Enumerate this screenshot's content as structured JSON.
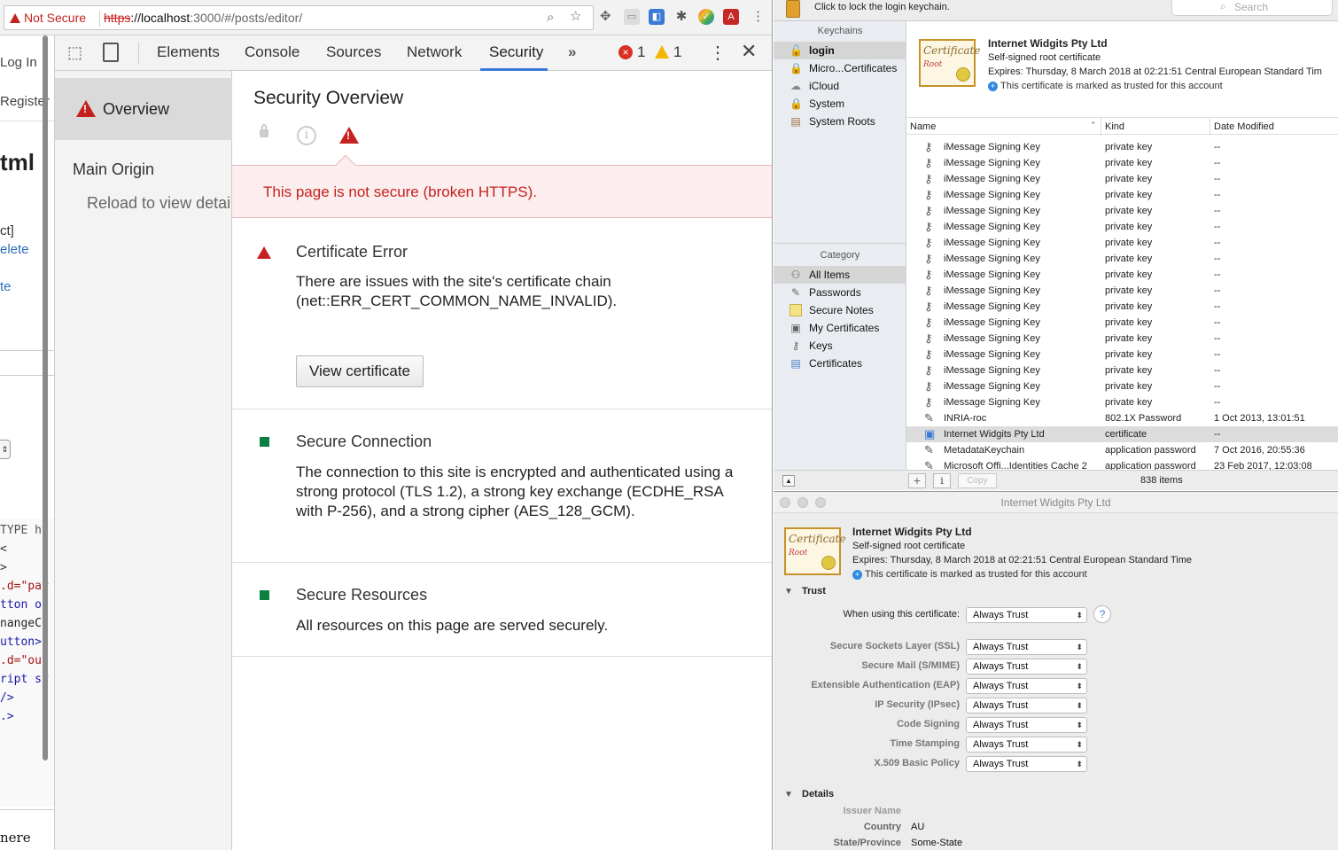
{
  "browser": {
    "not_secure_label": "Not Secure",
    "url_scheme": "https",
    "url_host": "://localhost",
    "url_rest": ":3000/#/posts/editor/"
  },
  "page": {
    "login_link": "Log In",
    "register_link": "Register",
    "heading_fragment": "tml",
    "bracket_fragment": "ct]",
    "delete_fragment": "elete",
    "te_fragment": "te",
    "code_lines": [
      "TYPE ht",
      "<",
      ">",
      ".d=\"par",
      "tton on",
      "nangeCo",
      "utton>",
      ".d=\"out",
      "ript sr",
      "/>",
      ".>"
    ],
    "bottom_fragment": "nere"
  },
  "devtools": {
    "tabs": [
      "Elements",
      "Console",
      "Sources",
      "Network",
      "Security"
    ],
    "more_tabs": "»",
    "error_count": "1",
    "warning_count": "1",
    "sidebar": {
      "overview": "Overview",
      "main_origin": "Main Origin",
      "reload_hint": "Reload to view detai"
    },
    "title": "Security Overview",
    "banner": "This page is not secure (broken HTTPS).",
    "sections": [
      {
        "title": "Certificate Error",
        "body": "There are issues with the site's certificate chain (net::ERR_CERT_COMMON_NAME_INVALID).",
        "button": "View certificate"
      },
      {
        "title": "Secure Connection",
        "body": "The connection to this site is encrypted and authenticated using a strong protocol (TLS 1.2), a strong key exchange (ECDHE_RSA with P-256), and a strong cipher (AES_128_GCM)."
      },
      {
        "title": "Secure Resources",
        "body": "All resources on this page are served securely."
      }
    ]
  },
  "keychain": {
    "lock_hint": "Click to lock the login keychain.",
    "search_placeholder": "Search",
    "keychains_header": "Keychains",
    "keychains": [
      "login",
      "Micro...Certificates",
      "iCloud",
      "System",
      "System Roots"
    ],
    "category_header": "Category",
    "categories": [
      "All Items",
      "Passwords",
      "Secure Notes",
      "My Certificates",
      "Keys",
      "Certificates"
    ],
    "detail": {
      "name": "Internet Widgits Pty Ltd",
      "type": "Self-signed root certificate",
      "expires": "Expires: Thursday, 8 March 2018 at 02:21:51 Central European Standard Tim",
      "trusted": "This certificate is marked as trusted for this account"
    },
    "columns": [
      "Name",
      "Kind",
      "Date Modified"
    ],
    "rows": [
      {
        "name": "iMessage Signing Key",
        "kind": "private key",
        "date": "--"
      },
      {
        "name": "iMessage Signing Key",
        "kind": "private key",
        "date": "--"
      },
      {
        "name": "iMessage Signing Key",
        "kind": "private key",
        "date": "--"
      },
      {
        "name": "iMessage Signing Key",
        "kind": "private key",
        "date": "--"
      },
      {
        "name": "iMessage Signing Key",
        "kind": "private key",
        "date": "--"
      },
      {
        "name": "iMessage Signing Key",
        "kind": "private key",
        "date": "--"
      },
      {
        "name": "iMessage Signing Key",
        "kind": "private key",
        "date": "--"
      },
      {
        "name": "iMessage Signing Key",
        "kind": "private key",
        "date": "--"
      },
      {
        "name": "iMessage Signing Key",
        "kind": "private key",
        "date": "--"
      },
      {
        "name": "iMessage Signing Key",
        "kind": "private key",
        "date": "--"
      },
      {
        "name": "iMessage Signing Key",
        "kind": "private key",
        "date": "--"
      },
      {
        "name": "iMessage Signing Key",
        "kind": "private key",
        "date": "--"
      },
      {
        "name": "iMessage Signing Key",
        "kind": "private key",
        "date": "--"
      },
      {
        "name": "iMessage Signing Key",
        "kind": "private key",
        "date": "--"
      },
      {
        "name": "iMessage Signing Key",
        "kind": "private key",
        "date": "--"
      },
      {
        "name": "iMessage Signing Key",
        "kind": "private key",
        "date": "--"
      },
      {
        "name": "iMessage Signing Key",
        "kind": "private key",
        "date": "--"
      },
      {
        "name": "INRIA-roc",
        "kind": "802.1X Password",
        "date": "1 Oct 2013, 13:01:51"
      },
      {
        "name": "Internet Widgits Pty Ltd",
        "kind": "certificate",
        "date": "--",
        "selected": true
      },
      {
        "name": "MetadataKeychain",
        "kind": "application password",
        "date": "7 Oct 2016, 20:55:36"
      },
      {
        "name": "Microsoft Offi...Identities Cache 2",
        "kind": "application password",
        "date": "23 Feb 2017, 12:03:08"
      }
    ],
    "footer": {
      "copy": "Copy",
      "count": "838 items"
    }
  },
  "cert_window": {
    "title": "Internet Widgits Pty Ltd",
    "name": "Internet Widgits Pty Ltd",
    "type": "Self-signed root certificate",
    "expires": "Expires: Thursday, 8 March 2018 at 02:21:51 Central European Standard Time",
    "trusted": "This certificate is marked as trusted for this account",
    "trust_header": "Trust",
    "when_using_label": "When using this certificate:",
    "when_using_value": "Always Trust",
    "trust_rows": [
      {
        "label": "Secure Sockets Layer (SSL)",
        "value": "Always Trust"
      },
      {
        "label": "Secure Mail (S/MIME)",
        "value": "Always Trust"
      },
      {
        "label": "Extensible Authentication (EAP)",
        "value": "Always Trust"
      },
      {
        "label": "IP Security (IPsec)",
        "value": "Always Trust"
      },
      {
        "label": "Code Signing",
        "value": "Always Trust"
      },
      {
        "label": "Time Stamping",
        "value": "Always Trust"
      },
      {
        "label": "X.509 Basic Policy",
        "value": "Always Trust"
      }
    ],
    "details_header": "Details",
    "details": [
      {
        "label": "Issuer Name",
        "value": ""
      },
      {
        "label": "Country",
        "value": "AU"
      },
      {
        "label": "State/Province",
        "value": "Some-State"
      }
    ]
  }
}
